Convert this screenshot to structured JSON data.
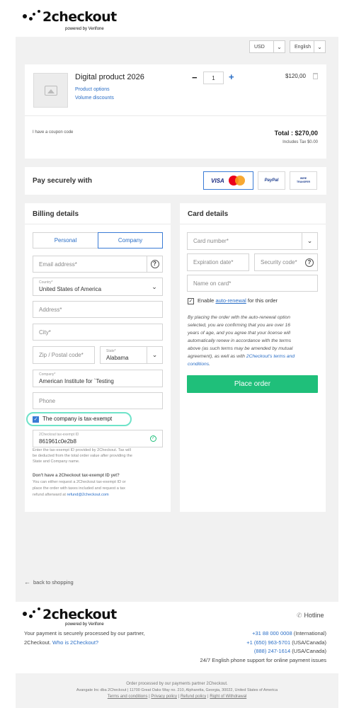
{
  "brand": {
    "name": "2checkout",
    "tagline": "powered by Verifone"
  },
  "topbar": {
    "currency": "USD",
    "language": "English"
  },
  "product": {
    "name": "Digital product 2026",
    "options_link": "Product options",
    "volume_link": "Volume discounts",
    "quantity": "1",
    "price": "$120,00"
  },
  "summary": {
    "coupon_link": "I have a coupon code",
    "total": "Total : $270,00",
    "tax_note": "Includes Tax $0.00"
  },
  "payment": {
    "title": "Pay securely with",
    "methods": [
      "VISA",
      "PayPal",
      "WIRE TRANSFER"
    ]
  },
  "billing": {
    "title": "Billing details",
    "tabs": [
      "Personal",
      "Company"
    ],
    "active_tab": "Company",
    "email_placeholder": "Email address*",
    "country_label": "Country*",
    "country_value": "United States of America",
    "address_placeholder": "Address*",
    "city_placeholder": "City*",
    "zip_placeholder": "Zip / Postal code*",
    "state_label": "State*",
    "state_value": "Alabama",
    "company_label": "Company*",
    "company_value": "American Institute for `Testing",
    "phone_placeholder": "Phone",
    "tax_exempt_label": "The company is tax-exempt",
    "tax_exempt_checked": true,
    "tax_id_label": "2Checkout tax-exempt ID",
    "tax_id_value": "861961c0e2b8",
    "tax_hint": [
      "Enter the tax-exempt ID provided by 2Checkout. Tax will",
      "be deducted from the total order value after providing the",
      "State and Company name."
    ],
    "no_id_title": "Don't have a 2Checkout tax-exempt ID yet?",
    "no_id_text": [
      "You can either request a 2Checkout tax-exempt ID or",
      "place the order with taxes included and request a tax",
      "refund afterward at"
    ],
    "refund_email": "refund@2checkout.com"
  },
  "card": {
    "title": "Card details",
    "number_placeholder": "Card number*",
    "expiration_placeholder": "Expiration date*",
    "cvv_placeholder": "Security code*",
    "name_placeholder": "Name on card*",
    "auto_renew_prefix": "Enable",
    "auto_renew_link": "auto-renewal",
    "auto_renew_suffix": "for this order",
    "terms_lines": [
      "By placing the order with the auto-renewal option",
      "selected, you are confirming that you are over 16",
      "years of age, and you agree that your license will",
      "automatically renew in accordance with the terms",
      "above (as such terms may be amended by mutual",
      "agreement), as well as with"
    ],
    "terms_link_a": "2Checkout's terms and",
    "terms_link_b": "conditions",
    "place_order": "Place order"
  },
  "back_link": "back to shopping",
  "footer": {
    "hotline": "Hotline",
    "processed_line1": "Your payment is securely processed by our partner,",
    "processed_line2": "2Checkout.",
    "who_link": "Who is 2Checkout?",
    "phones": [
      {
        "number": "+31 88 000 0008",
        "region": "(International)"
      },
      {
        "number": "+1 (650) 963-5701",
        "region": "(USA/Canada)"
      },
      {
        "number": "(888) 247-1614",
        "region": "(USA/Canada)"
      }
    ],
    "support": "24/7 English phone support for online payment issues",
    "legal1": "Order processed by our payments partner 2Checkout.",
    "legal2": "Avangate Inc dba 2Checkout | 11700 Great Oaks Way no. 210, Alpharetta, Georgia, 30022, United States of America",
    "links": [
      "Terms and conditions",
      "Privacy policy",
      "Refund policy",
      "Right of Withdrawal"
    ]
  }
}
